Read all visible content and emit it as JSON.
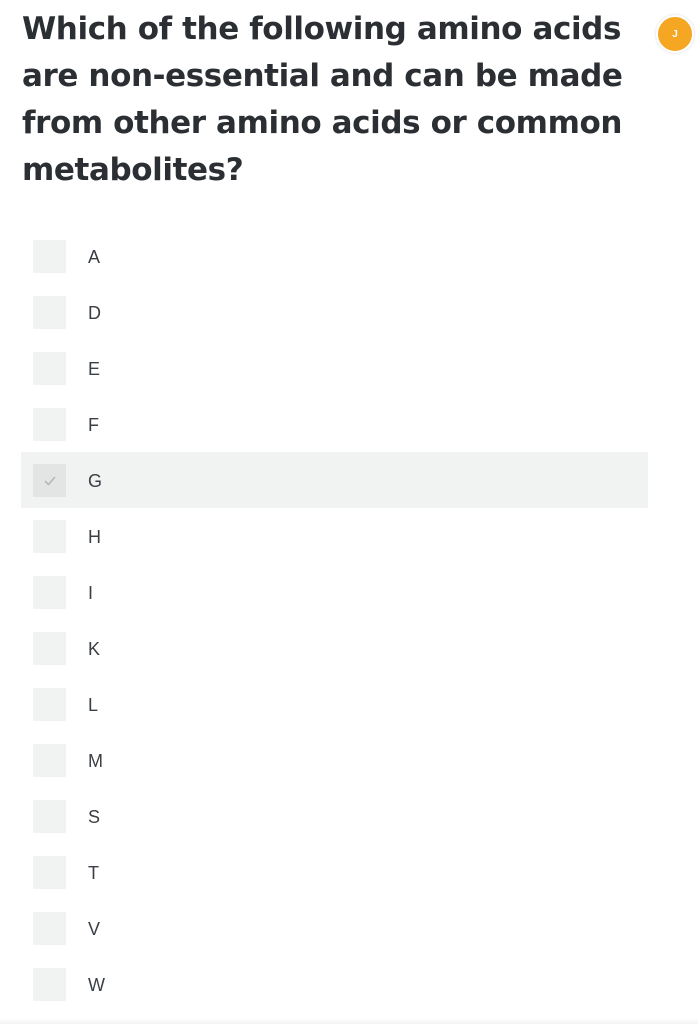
{
  "question": {
    "text": "Which of the following amino acids are non-essential and can be made from other amino acids or common metabolites?"
  },
  "avatar": {
    "initial": "J",
    "color": "#f5a623"
  },
  "options": [
    {
      "label": "A",
      "checked": false
    },
    {
      "label": "D",
      "checked": false
    },
    {
      "label": "E",
      "checked": false
    },
    {
      "label": "F",
      "checked": false
    },
    {
      "label": "G",
      "checked": true
    },
    {
      "label": "H",
      "checked": false
    },
    {
      "label": "I",
      "checked": false
    },
    {
      "label": "K",
      "checked": false
    },
    {
      "label": "L",
      "checked": false
    },
    {
      "label": "M",
      "checked": false
    },
    {
      "label": "S",
      "checked": false
    },
    {
      "label": "T",
      "checked": false
    },
    {
      "label": "V",
      "checked": false
    },
    {
      "label": "W",
      "checked": false
    }
  ]
}
